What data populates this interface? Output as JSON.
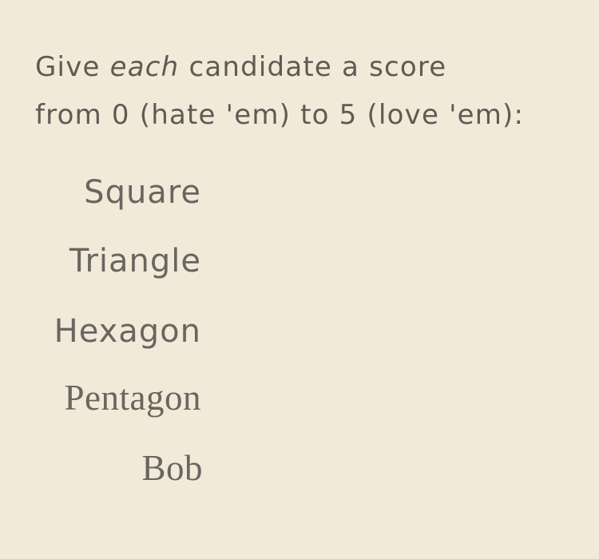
{
  "prompt": {
    "line1_pre": "Give ",
    "line1_em": "each",
    "line1_post": " candidate a score",
    "line2": "from 0 (hate 'em) to 5 (love 'em):"
  },
  "candidates": [
    {
      "label": "Square"
    },
    {
      "label": "Triangle"
    },
    {
      "label": "Hexagon"
    },
    {
      "label": "Pentagon"
    },
    {
      "label": "Bob"
    }
  ],
  "colors": {
    "background": "#f2ead9",
    "text": "#5f5a55"
  }
}
